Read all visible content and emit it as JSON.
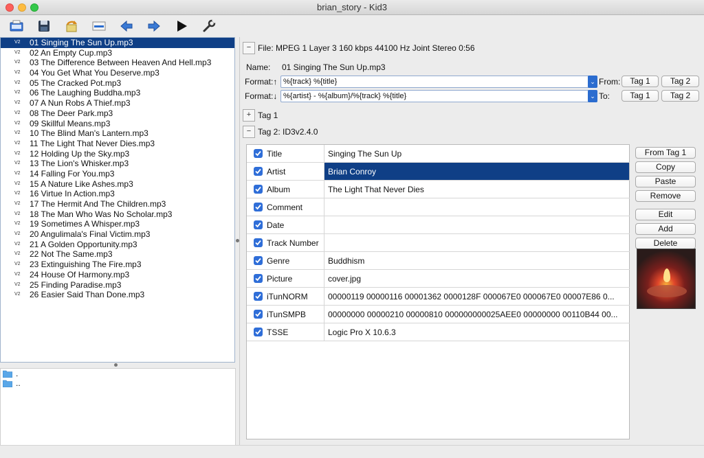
{
  "window": {
    "title": "brian_story - Kid3"
  },
  "toolbar": {
    "items": [
      "open-folder-icon",
      "save-icon",
      "revert-icon",
      "rename-icon",
      "previous-icon",
      "next-icon",
      "play-icon",
      "settings-icon"
    ]
  },
  "files": [
    {
      "tag": "V2",
      "name": "01 Singing The Sun Up.mp3"
    },
    {
      "tag": "V2",
      "name": "02 An Empty Cup.mp3"
    },
    {
      "tag": "V2",
      "name": "03 The Difference Between Heaven And Hell.mp3"
    },
    {
      "tag": "V2",
      "name": "04 You Get What You Deserve.mp3"
    },
    {
      "tag": "V2",
      "name": "05 The Cracked Pot.mp3"
    },
    {
      "tag": "V2",
      "name": "06 The Laughing Buddha.mp3"
    },
    {
      "tag": "V2",
      "name": "07 A Nun Robs A Thief.mp3"
    },
    {
      "tag": "V2",
      "name": "08 The Deer Park.mp3"
    },
    {
      "tag": "V2",
      "name": "09 Skillful Means.mp3"
    },
    {
      "tag": "V2",
      "name": "10 The Blind Man's Lantern.mp3"
    },
    {
      "tag": "V2",
      "name": "11 The Light That Never Dies.mp3"
    },
    {
      "tag": "V2",
      "name": "12 Holding Up the Sky.mp3"
    },
    {
      "tag": "V2",
      "name": "13 The Lion's Whisker.mp3"
    },
    {
      "tag": "V2",
      "name": "14 Falling For You.mp3"
    },
    {
      "tag": "V2",
      "name": "15 A Nature Like Ashes.mp3"
    },
    {
      "tag": "V2",
      "name": "16 Virtue In Action.mp3"
    },
    {
      "tag": "V2",
      "name": "17 The Hermit And The Children.mp3"
    },
    {
      "tag": "V2",
      "name": "18 The Man Who Was No Scholar.mp3"
    },
    {
      "tag": "V2",
      "name": "19 Sometimes A Whisper.mp3"
    },
    {
      "tag": "V2",
      "name": "20 Angulimala's Final Victim.mp3"
    },
    {
      "tag": "V2",
      "name": "21 A Golden Opportunity.mp3"
    },
    {
      "tag": "V2",
      "name": "22 Not The Same.mp3"
    },
    {
      "tag": "V2",
      "name": "23 Extinguishing The Fire.mp3"
    },
    {
      "tag": "V2",
      "name": "24 House Of Harmony.mp3"
    },
    {
      "tag": "V2",
      "name": "25 Finding Paradise.mp3"
    },
    {
      "tag": "V2",
      "name": "26 Easier Said Than Done.mp3"
    }
  ],
  "selected_file_index": 0,
  "dirs": [
    ".",
    ".."
  ],
  "file_section": {
    "collapse_symbol": "−",
    "header": "File: MPEG 1 Layer 3 160 kbps 44100 Hz Joint Stereo 0:56",
    "name_label": "Name:",
    "name_value": "01 Singing The Sun Up.mp3",
    "format_up_label": "Format:↑",
    "format_up_value": "%{track} %{title}",
    "format_down_label": "Format:↓",
    "format_down_value": "%{artist} - %{album}/%{track} %{title}",
    "from_label": "From:",
    "to_label": "To:",
    "tag1_button": "Tag 1",
    "tag2_button": "Tag 2"
  },
  "tag1_section": {
    "expand_symbol": "+",
    "header": "Tag 1"
  },
  "tag2_section": {
    "collapse_symbol": "−",
    "header": "Tag 2: ID3v2.4.0"
  },
  "tag_rows": [
    {
      "name": "Title",
      "value": "Singing The Sun Up",
      "checked": true
    },
    {
      "name": "Artist",
      "value": "Brian Conroy",
      "checked": true
    },
    {
      "name": "Album",
      "value": "The Light That Never Dies",
      "checked": true
    },
    {
      "name": "Comment",
      "value": "",
      "checked": true
    },
    {
      "name": "Date",
      "value": "",
      "checked": true
    },
    {
      "name": "Track Number",
      "value": "",
      "checked": true
    },
    {
      "name": "Genre",
      "value": "Buddhism",
      "checked": true
    },
    {
      "name": "Picture",
      "value": "cover.jpg",
      "checked": true
    },
    {
      "name": "iTunNORM",
      "value": " 00000119 00000116 00001362 0000128F 000067E0 000067E0 00007E86 0...",
      "checked": true
    },
    {
      "name": "iTunSMPB",
      "value": " 00000000 00000210 00000810 000000000025AEE0 00000000 00110B44 00...",
      "checked": true
    },
    {
      "name": "TSSE",
      "value": "Logic Pro X 10.6.3",
      "checked": true
    }
  ],
  "selected_tag_row": 1,
  "tag_buttons": {
    "from_tag1": "From Tag 1",
    "copy": "Copy",
    "paste": "Paste",
    "remove": "Remove",
    "edit": "Edit",
    "add": "Add",
    "delete": "Delete"
  },
  "colors": {
    "selection": "#0f3f86",
    "checkbox": "#2f6ed8",
    "accent": "#2b6ccf"
  }
}
